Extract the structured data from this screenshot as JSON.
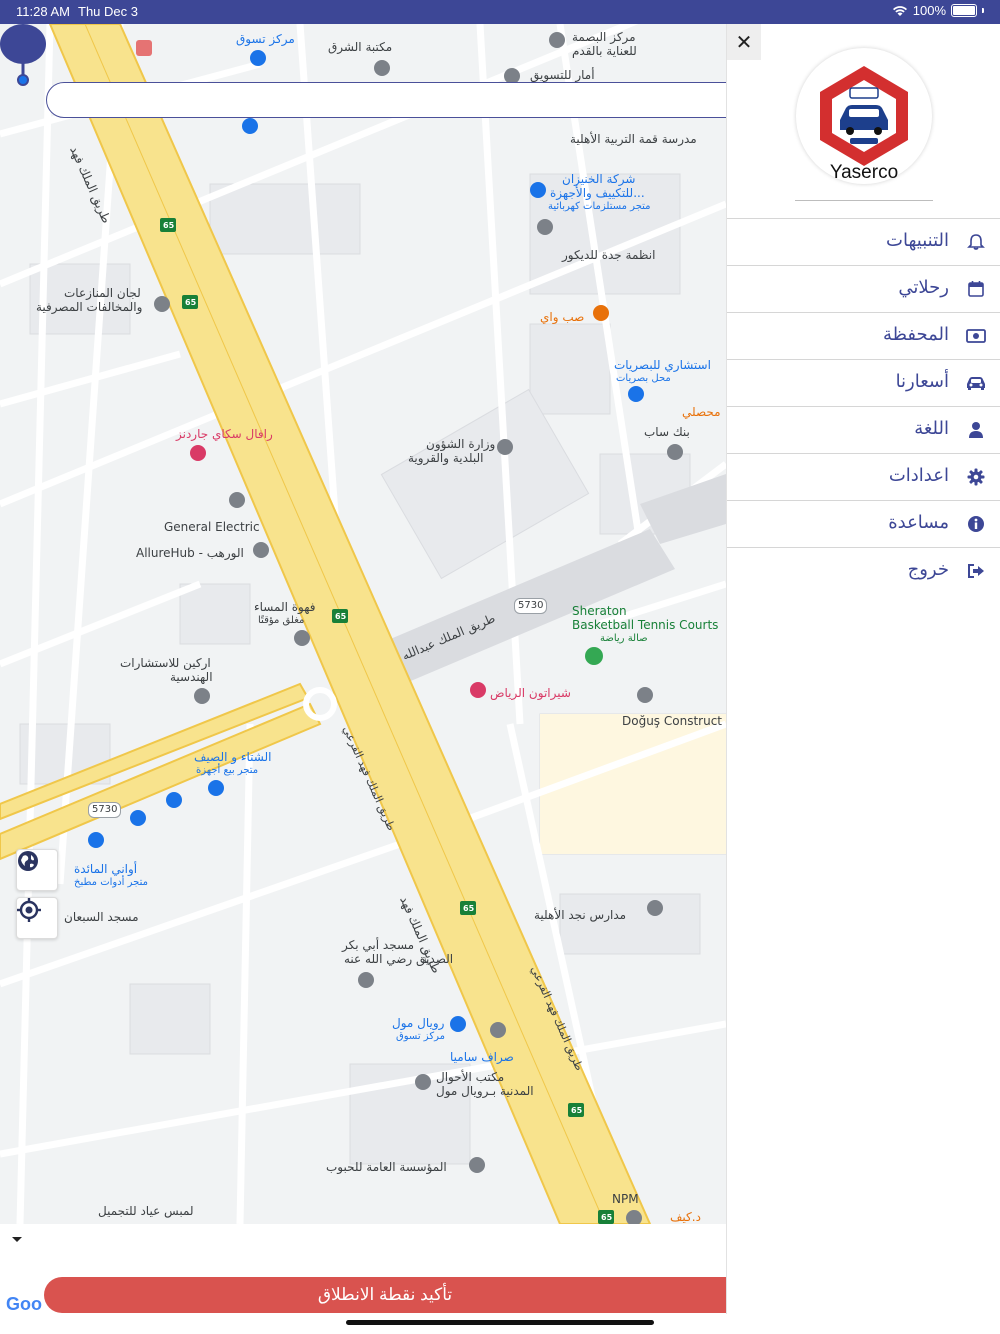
{
  "status_bar": {
    "time": "11:28 AM",
    "date": "Thu Dec 3",
    "battery": "100%"
  },
  "map": {
    "labels": [
      {
        "text": "مكتبة الشرق",
        "cls": "dark"
      },
      {
        "text": "مركز البصمة",
        "cls": "dark"
      },
      {
        "text": "للعناية بالقدم",
        "cls": "dark"
      },
      {
        "text": "مركز تسوق",
        "cls": "blue"
      },
      {
        "text": "أمار للتسويق",
        "cls": "dark"
      },
      {
        "text": "مدرسة قمة التربية الأهلية",
        "cls": "dark"
      },
      {
        "text": "شركة الخنيزان",
        "cls": "blue"
      },
      {
        "text": "للتكييف والأجهزة...",
        "cls": "blue"
      },
      {
        "text": "متجر مستلزمات كهربائية",
        "cls": "blue"
      },
      {
        "text": "انظمة جدة للديكور",
        "cls": "dark"
      },
      {
        "text": "لجان المنازعات",
        "cls": "dark"
      },
      {
        "text": "والمخالفات المصرفية",
        "cls": "dark"
      },
      {
        "text": "صب واي",
        "cls": "orange"
      },
      {
        "text": "استشاري للبصريات",
        "cls": "blue"
      },
      {
        "text": "محل بصريات",
        "cls": "blue"
      },
      {
        "text": "محصلي",
        "cls": "orange"
      },
      {
        "text": "بنك ساب",
        "cls": "dark"
      },
      {
        "text": "رافال سكاي جاردنز",
        "cls": "red"
      },
      {
        "text": "وزارة الشؤون",
        "cls": "dark"
      },
      {
        "text": "البلدية والقروية",
        "cls": "dark"
      },
      {
        "text": "General Electric",
        "cls": "dark"
      },
      {
        "text": "AllureHub - الورهب",
        "cls": "dark"
      },
      {
        "text": "فهوة المساء",
        "cls": "dark"
      },
      {
        "text": "مغلق مؤقتًا",
        "cls": "dark"
      },
      {
        "text": "Sheraton",
        "cls": "green"
      },
      {
        "text": "Basketball Tennis Courts",
        "cls": "green"
      },
      {
        "text": "صالة رياضة",
        "cls": "green"
      },
      {
        "text": "اركين للاستشارات",
        "cls": "dark"
      },
      {
        "text": "الهندسية",
        "cls": "dark"
      },
      {
        "text": "شيراتون الرياض",
        "cls": "red"
      },
      {
        "text": "Doğuş Construct",
        "cls": "dark"
      },
      {
        "text": "الشتاء و الصيف",
        "cls": "blue"
      },
      {
        "text": "متجر بيع أجهزة",
        "cls": "blue"
      },
      {
        "text": "أواني المائدة",
        "cls": "blue"
      },
      {
        "text": "متجر أدوات مطبخ",
        "cls": "blue"
      },
      {
        "text": "مسجد السبعان",
        "cls": "dark"
      },
      {
        "text": "مدارس نجد الأهلية",
        "cls": "dark"
      },
      {
        "text": "مسجد أبي بكر",
        "cls": "dark"
      },
      {
        "text": "الصديق رضي الله عنه",
        "cls": "dark"
      },
      {
        "text": "رويال مول",
        "cls": "blue"
      },
      {
        "text": "مركز تسوق",
        "cls": "blue"
      },
      {
        "text": "صراف ساميا",
        "cls": "blue"
      },
      {
        "text": "مكتب الأحوال",
        "cls": "dark"
      },
      {
        "text": "المدنية بـرويال مول",
        "cls": "dark"
      },
      {
        "text": "المؤسسة العامة للحبوب",
        "cls": "dark"
      },
      {
        "text": "NPM",
        "cls": "dark"
      },
      {
        "text": "لمبس عياد للتجميل",
        "cls": "dark"
      },
      {
        "text": "د.كيف",
        "cls": "orange"
      },
      {
        "text": "طريق الملك فهد",
        "cls": "dark"
      },
      {
        "text": "طريق الملك فهد",
        "cls": "dark"
      },
      {
        "text": "طريق الملك عبدالله",
        "cls": "dark"
      },
      {
        "text": "طريق الملك فهد الفرعي",
        "cls": "dark"
      },
      {
        "text": "طريق الملك فهد الفرعي",
        "cls": "dark"
      },
      {
        "text": "5730",
        "cls": "dark"
      },
      {
        "text": "5730",
        "cls": "dark"
      },
      {
        "text": "65",
        "cls": "green"
      },
      {
        "text": "65",
        "cls": "green"
      },
      {
        "text": "65",
        "cls": "green"
      },
      {
        "text": "65",
        "cls": "green"
      },
      {
        "text": "65",
        "cls": "green"
      },
      {
        "text": "65",
        "cls": "green"
      }
    ]
  },
  "search": {
    "placeholder": ""
  },
  "google_logo": "Goo",
  "confirm_button": "تأكيد نقطة الانطلاق",
  "drawer": {
    "brand": "Yaserco",
    "menu": [
      {
        "label": "التنبيهات",
        "icon": "bell-icon"
      },
      {
        "label": "رحلاتي",
        "icon": "calendar-icon"
      },
      {
        "label": "المحفظة",
        "icon": "money-icon"
      },
      {
        "label": "أسعارنا",
        "icon": "car-icon"
      },
      {
        "label": "اللغة",
        "icon": "user-icon"
      },
      {
        "label": "اعدادات",
        "icon": "gear-icon"
      },
      {
        "label": "مساعدة",
        "icon": "info-icon"
      },
      {
        "label": "خروج",
        "icon": "sign-out-icon"
      }
    ]
  },
  "colors": {
    "accent": "#3d4796",
    "confirm": "#d9534f",
    "highway": "#f8e38d"
  }
}
